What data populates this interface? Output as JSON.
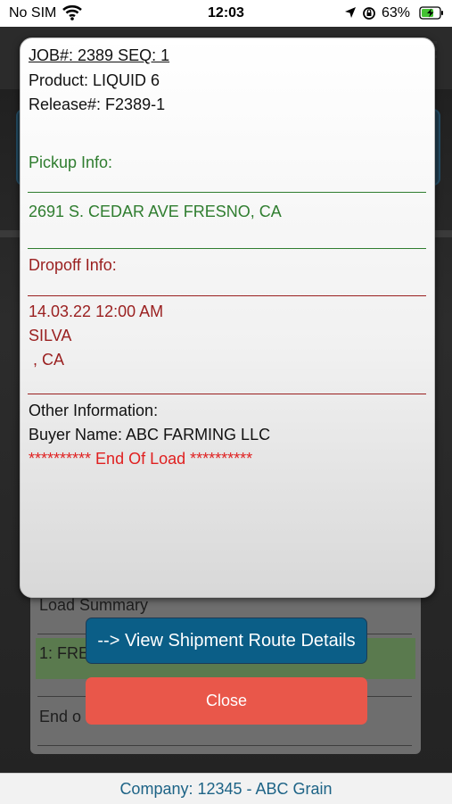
{
  "status_bar": {
    "carrier": "No SIM",
    "time": "12:03",
    "battery_percent": "63%",
    "icons": [
      "wifi-icon",
      "location-arrow-icon",
      "rotation-lock-icon",
      "battery-charging-icon"
    ]
  },
  "modal": {
    "job_line": "JOB#: 2389 SEQ: 1",
    "product": "Product: LIQUID 6",
    "release": "Release#: F2389-1",
    "pickup_label": "Pickup Info:",
    "pickup_address": "2691 S. CEDAR AVE FRESNO, CA",
    "dropoff_label": "Dropoff Info:",
    "dropoff_datetime": "14.03.22 12:00 AM",
    "dropoff_name": "SILVA",
    "dropoff_location": " , CA",
    "other_label": "Other Information:",
    "buyer": "Buyer Name: ABC FARMING LLC",
    "end_of_load": "********** End Of Load **********"
  },
  "background_card": {
    "title": "Load Summary",
    "row1": "1: FRE",
    "row2": "End o"
  },
  "buttons": {
    "route_details": "--> View Shipment Route Details",
    "close": "Close"
  },
  "footer": {
    "company": "Company: 12345 - ABC Grain"
  },
  "colors": {
    "pickup_green": "#2f7d2f",
    "dropoff_red": "#9a1f1f",
    "end_red": "#e02020",
    "route_button": "#0b5e87",
    "close_button": "#e9574a",
    "footer_text": "#1d6386"
  }
}
